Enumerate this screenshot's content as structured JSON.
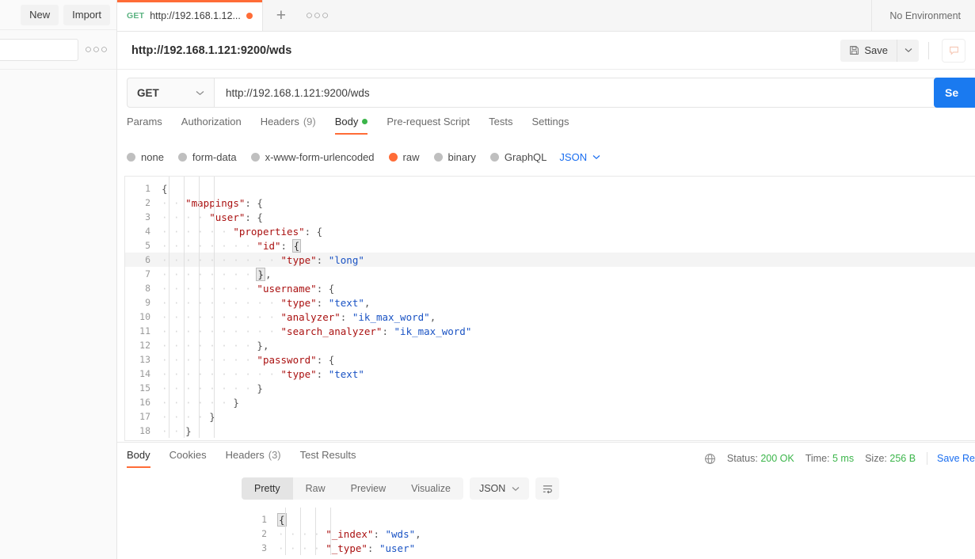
{
  "sidebar": {
    "new_label": "New",
    "import_label": "Import",
    "more_icon": "more-horizontal-icon",
    "search_placeholder": ""
  },
  "tabbar": {
    "tabs": [
      {
        "method": "GET",
        "title": "http://192.168.1.12...",
        "unsaved": true
      }
    ],
    "new_tab_label": "+",
    "more_icon": "more-horizontal-icon",
    "environment": "No Environment"
  },
  "request_header": {
    "name": "http://192.168.1.121:9200/wds",
    "save_label": "Save",
    "save_icon": "floppy-disk-icon",
    "caret_icon": "chevron-down-icon"
  },
  "url_row": {
    "method": "GET",
    "method_caret": "chevron-down-icon",
    "url": "http://192.168.1.121:9200/wds",
    "send_label": "Se"
  },
  "request_tabs": [
    {
      "label": "Params",
      "active": false
    },
    {
      "label": "Authorization",
      "active": false
    },
    {
      "label": "Headers",
      "count": "(9)",
      "active": false
    },
    {
      "label": "Body",
      "dot": true,
      "active": true
    },
    {
      "label": "Pre-request Script",
      "active": false
    },
    {
      "label": "Tests",
      "active": false
    },
    {
      "label": "Settings",
      "active": false
    }
  ],
  "body_types": [
    {
      "label": "none",
      "selected": false
    },
    {
      "label": "form-data",
      "selected": false
    },
    {
      "label": "x-www-form-urlencoded",
      "selected": false
    },
    {
      "label": "raw",
      "selected": true
    },
    {
      "label": "binary",
      "selected": false
    },
    {
      "label": "GraphQL",
      "selected": false
    }
  ],
  "body_format": {
    "label": "JSON",
    "caret": "chevron-down-icon"
  },
  "request_body_lines": [
    {
      "n": "1",
      "indent": 0,
      "active": false,
      "tokens": [
        {
          "t": "{",
          "c": "p"
        }
      ]
    },
    {
      "n": "2",
      "indent": 1,
      "active": false,
      "tokens": [
        {
          "t": "\"mappings\"",
          "c": "k"
        },
        {
          "t": ": {",
          "c": "p"
        }
      ]
    },
    {
      "n": "3",
      "indent": 2,
      "active": false,
      "tokens": [
        {
          "t": "\"user\"",
          "c": "k"
        },
        {
          "t": ": {",
          "c": "p"
        }
      ]
    },
    {
      "n": "4",
      "indent": 3,
      "active": false,
      "tokens": [
        {
          "t": "\"properties\"",
          "c": "k"
        },
        {
          "t": ": {",
          "c": "p"
        }
      ]
    },
    {
      "n": "5",
      "indent": 4,
      "active": false,
      "tokens": [
        {
          "t": "\"id\"",
          "c": "k"
        },
        {
          "t": ": ",
          "c": "p"
        },
        {
          "t": "{",
          "c": "caret"
        }
      ]
    },
    {
      "n": "6",
      "indent": 5,
      "active": true,
      "tokens": [
        {
          "t": "\"type\"",
          "c": "k"
        },
        {
          "t": ": ",
          "c": "p"
        },
        {
          "t": "\"long\"",
          "c": "s"
        }
      ]
    },
    {
      "n": "7",
      "indent": 4,
      "active": false,
      "tokens": [
        {
          "t": "}",
          "c": "caret"
        },
        {
          "t": ",",
          "c": "p"
        }
      ]
    },
    {
      "n": "8",
      "indent": 4,
      "active": false,
      "tokens": [
        {
          "t": "\"username\"",
          "c": "k"
        },
        {
          "t": ": {",
          "c": "p"
        }
      ]
    },
    {
      "n": "9",
      "indent": 5,
      "active": false,
      "tokens": [
        {
          "t": "\"type\"",
          "c": "k"
        },
        {
          "t": ": ",
          "c": "p"
        },
        {
          "t": "\"text\"",
          "c": "s"
        },
        {
          "t": ",",
          "c": "p"
        }
      ]
    },
    {
      "n": "10",
      "indent": 5,
      "active": false,
      "tokens": [
        {
          "t": "\"analyzer\"",
          "c": "k"
        },
        {
          "t": ": ",
          "c": "p"
        },
        {
          "t": "\"ik_max_word\"",
          "c": "s"
        },
        {
          "t": ",",
          "c": "p"
        }
      ]
    },
    {
      "n": "11",
      "indent": 5,
      "active": false,
      "tokens": [
        {
          "t": "\"search_analyzer\"",
          "c": "k"
        },
        {
          "t": ": ",
          "c": "p"
        },
        {
          "t": "\"ik_max_word\"",
          "c": "s"
        }
      ]
    },
    {
      "n": "12",
      "indent": 4,
      "active": false,
      "tokens": [
        {
          "t": "},",
          "c": "p"
        }
      ]
    },
    {
      "n": "13",
      "indent": 4,
      "active": false,
      "tokens": [
        {
          "t": "\"password\"",
          "c": "k"
        },
        {
          "t": ": {",
          "c": "p"
        }
      ]
    },
    {
      "n": "14",
      "indent": 5,
      "active": false,
      "tokens": [
        {
          "t": "\"type\"",
          "c": "k"
        },
        {
          "t": ": ",
          "c": "p"
        },
        {
          "t": "\"text\"",
          "c": "s"
        }
      ]
    },
    {
      "n": "15",
      "indent": 4,
      "active": false,
      "tokens": [
        {
          "t": "}",
          "c": "p"
        }
      ]
    },
    {
      "n": "16",
      "indent": 3,
      "active": false,
      "tokens": [
        {
          "t": "}",
          "c": "p"
        }
      ]
    },
    {
      "n": "17",
      "indent": 2,
      "active": false,
      "tokens": [
        {
          "t": "}",
          "c": "p"
        }
      ]
    },
    {
      "n": "18",
      "indent": 1,
      "active": false,
      "tokens": [
        {
          "t": "}",
          "c": "p"
        }
      ]
    }
  ],
  "response": {
    "tabs": [
      {
        "label": "Body",
        "active": true
      },
      {
        "label": "Cookies",
        "active": false
      },
      {
        "label": "Headers",
        "count": "(3)",
        "active": false
      },
      {
        "label": "Test Results",
        "active": false
      }
    ],
    "globe_icon": "globe-icon",
    "status_label": "Status:",
    "status_value": "200 OK",
    "time_label": "Time:",
    "time_value": "5 ms",
    "size_label": "Size:",
    "size_value": "256 B",
    "save_response": "Save Re",
    "views": [
      {
        "label": "Pretty",
        "active": true
      },
      {
        "label": "Raw",
        "active": false
      },
      {
        "label": "Preview",
        "active": false
      },
      {
        "label": "Visualize",
        "active": false
      }
    ],
    "format": {
      "label": "JSON",
      "caret": "chevron-down-icon"
    },
    "wrap_icon": "word-wrap-icon",
    "body_lines": [
      {
        "n": "1",
        "indent": 0,
        "tokens": [
          {
            "t": "{",
            "c": "caret"
          }
        ]
      },
      {
        "n": "2",
        "indent": 2,
        "tokens": [
          {
            "t": "\"_index\"",
            "c": "k"
          },
          {
            "t": ": ",
            "c": "p"
          },
          {
            "t": "\"wds\"",
            "c": "s"
          },
          {
            "t": ",",
            "c": "p"
          }
        ]
      },
      {
        "n": "3",
        "indent": 2,
        "tokens": [
          {
            "t": "\"_type\"",
            "c": "k"
          },
          {
            "t": ": ",
            "c": "p"
          },
          {
            "t": "\"user\"",
            "c": "s"
          }
        ]
      }
    ]
  },
  "colors": {
    "accent_orange": "#ff6c37",
    "send_blue": "#1a7af0",
    "link_blue": "#1a6ef0",
    "success_green": "#3bb54a",
    "method_green": "#5bb381"
  }
}
